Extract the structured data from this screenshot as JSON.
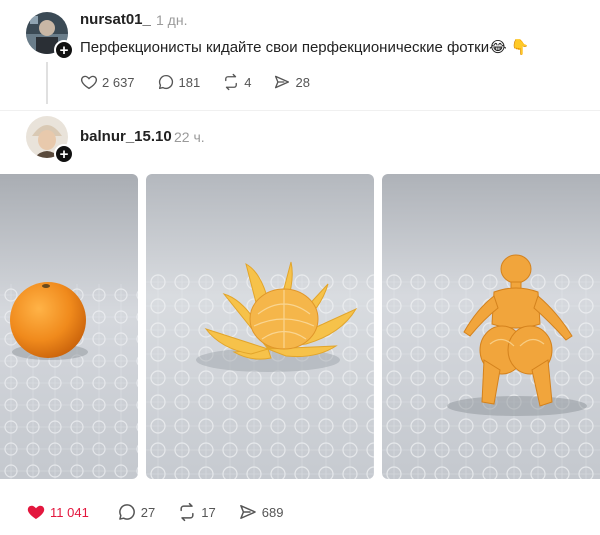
{
  "post1": {
    "username": "nursat01_",
    "time": "1 дн.",
    "text": "Перфекционисты кидайте свои перфекционические фотки",
    "emoji": "😂 👇",
    "likes": "2 637",
    "comments": "181",
    "reposts": "4",
    "shares": "28"
  },
  "post2": {
    "username": "balnur_15.10",
    "time": "22 ч.",
    "likes": "11 041",
    "comments": "27",
    "reposts": "17",
    "shares": "689"
  },
  "colors": {
    "like_red": "#e3173e",
    "orange": "#f08a1c",
    "tablecloth": "#c9cdd4"
  },
  "icons": [
    "heart-icon",
    "comment-icon",
    "repost-icon",
    "share-icon",
    "plus-icon"
  ]
}
